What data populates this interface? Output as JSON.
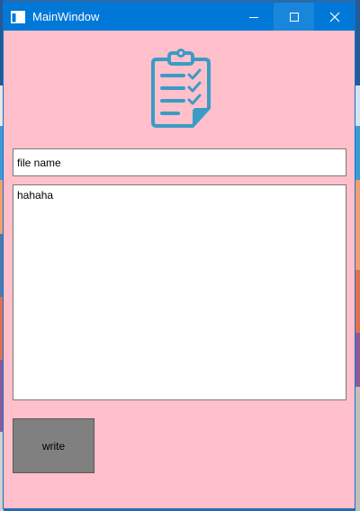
{
  "window": {
    "title": "MainWindow",
    "titlebar_color": "#0078d7",
    "client_background": "#ffc0cb"
  },
  "titlebar_buttons": {
    "minimize_icon": "minimize-icon",
    "maximize_icon": "maximize-icon",
    "close_icon": "close-icon"
  },
  "logo": {
    "icon": "clipboard-checklist-icon",
    "color": "#3a9cc4"
  },
  "form": {
    "filename_value": "file name",
    "content_value": "hahaha",
    "write_label": "write",
    "write_button_color": "#808080"
  }
}
